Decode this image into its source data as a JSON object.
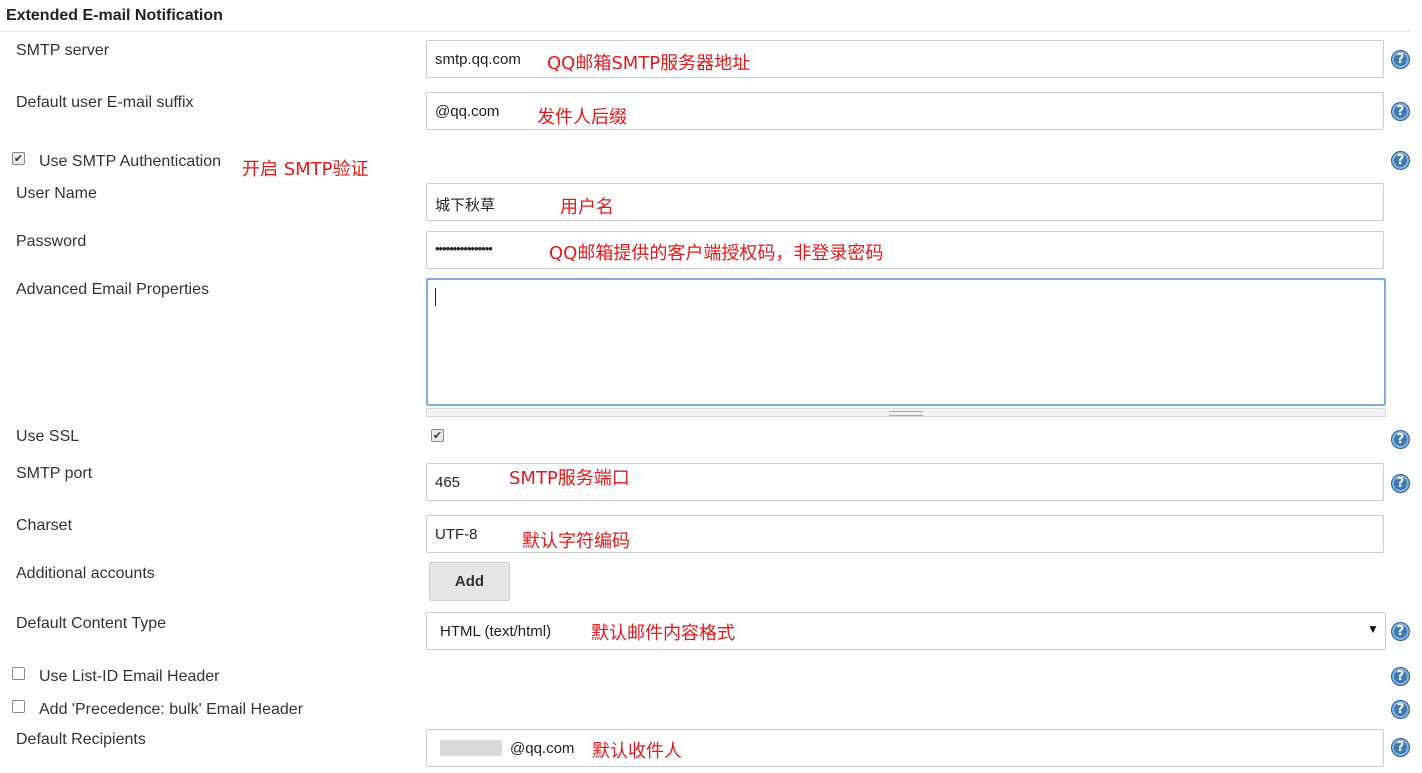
{
  "section": {
    "title": "Extended E-mail Notification"
  },
  "fields": {
    "smtp_server": {
      "label": "SMTP server",
      "value": "smtp.qq.com",
      "note": "QQ邮箱SMTP服务器地址"
    },
    "email_suffix": {
      "label": "Default user E-mail suffix",
      "value": "@qq.com",
      "note": "发件人后缀"
    },
    "use_auth": {
      "label": "Use SMTP Authentication",
      "checked": true,
      "note": "开启 SMTP验证"
    },
    "user_name": {
      "label": "User Name",
      "value": "城下秋草",
      "note": "用户名"
    },
    "password": {
      "label": "Password",
      "value": "••••••••••••••••",
      "note": "QQ邮箱提供的客户端授权码，非登录密码"
    },
    "advanced_props": {
      "label": "Advanced Email Properties",
      "value": ""
    },
    "use_ssl": {
      "label": "Use SSL",
      "checked": true
    },
    "smtp_port": {
      "label": "SMTP port",
      "value": "465",
      "note": "SMTP服务端口"
    },
    "charset": {
      "label": "Charset",
      "value": "UTF-8",
      "note": "默认字符编码"
    },
    "additional_accounts": {
      "label": "Additional accounts",
      "button": "Add"
    },
    "content_type": {
      "label": "Default Content Type",
      "value": "HTML (text/html)",
      "note": "默认邮件内容格式"
    },
    "list_id": {
      "label": "Use List-ID Email Header",
      "checked": false
    },
    "precedence": {
      "label": "Add 'Precedence: bulk' Email Header",
      "checked": false
    },
    "recipients": {
      "label": "Default Recipients",
      "value": "@qq.com",
      "note": "默认收件人"
    }
  },
  "icons": {
    "help": "help-icon",
    "check": "checkmark-icon",
    "dropdown": "caret-down-icon"
  },
  "colors": {
    "note": "#e0191b",
    "help": "#3e79b6",
    "focus_border": "#7fb0e3"
  }
}
